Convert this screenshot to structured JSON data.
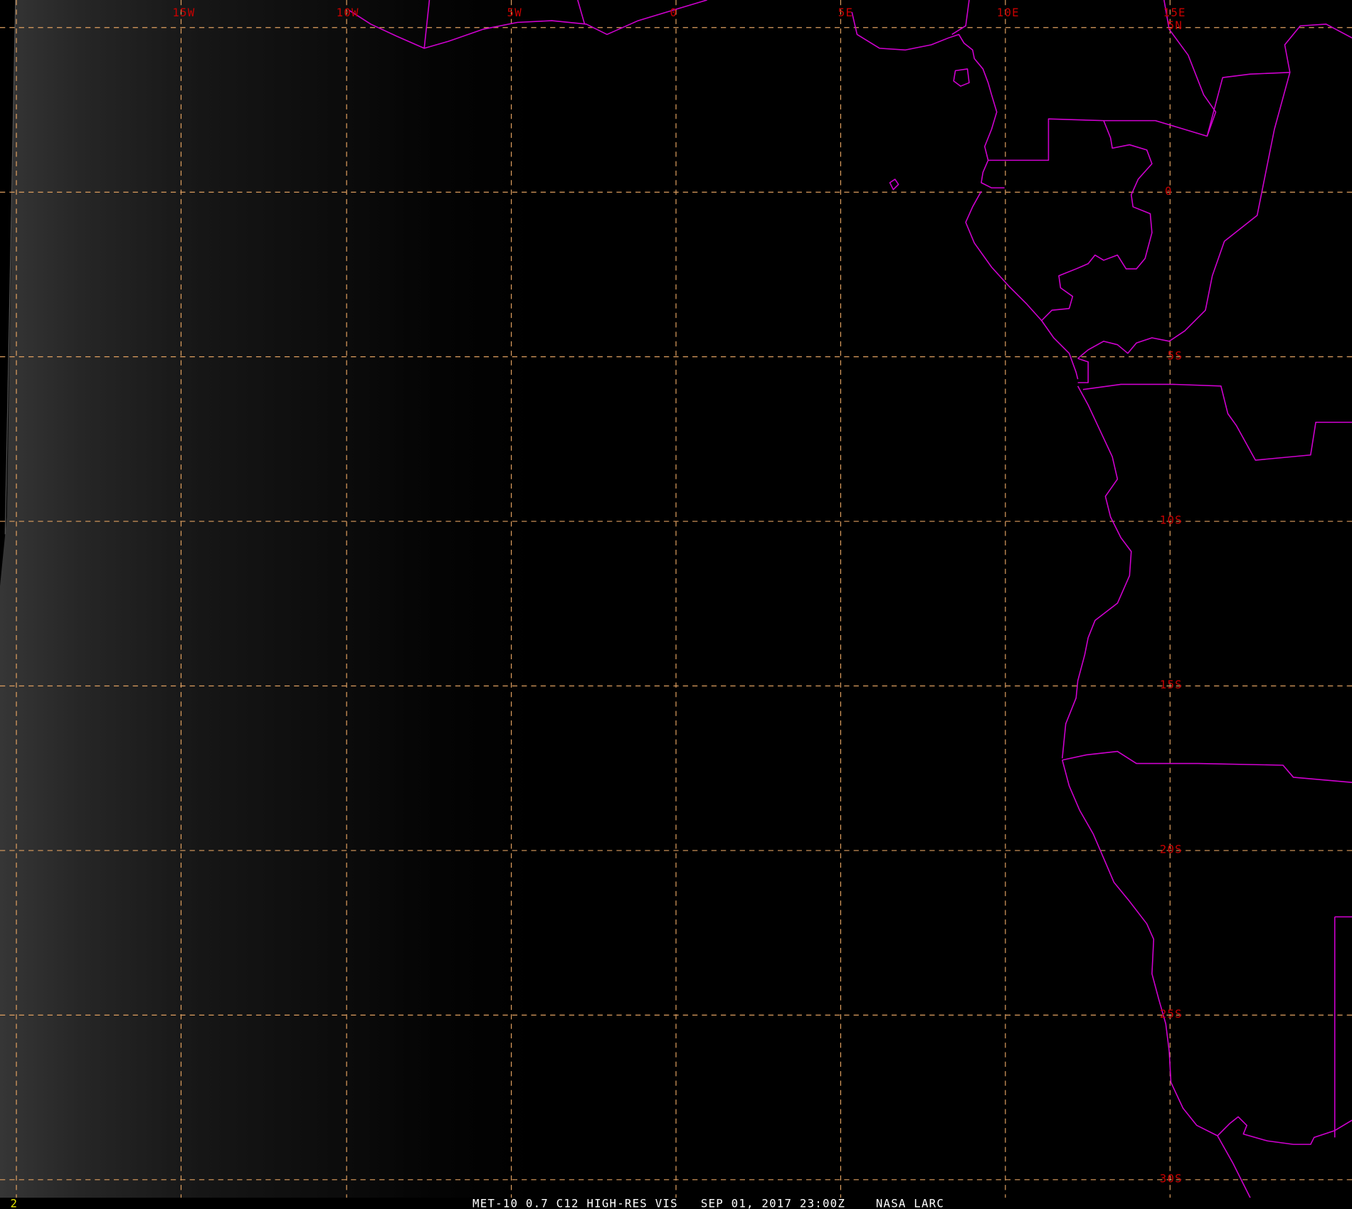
{
  "colors": {
    "background": "#000000",
    "graticule": "#e0a060",
    "coastline": "#d000d0",
    "grid_label": "#c80000",
    "caption": "#ffffff",
    "frame_number": "#e6e600"
  },
  "longitude_labels": [
    "15W",
    "10W",
    "5W",
    "0",
    "5E",
    "10E",
    "15E"
  ],
  "latitude_labels": [
    "5N",
    "0",
    "5S",
    "10S",
    "15S",
    "20S",
    "25S",
    "30S"
  ],
  "footer": {
    "frame_number": "2",
    "caption": "MET-10 0.7 C12 HIGH-RES VIS   SEP 01, 2017 23:00Z    NASA LARC"
  }
}
